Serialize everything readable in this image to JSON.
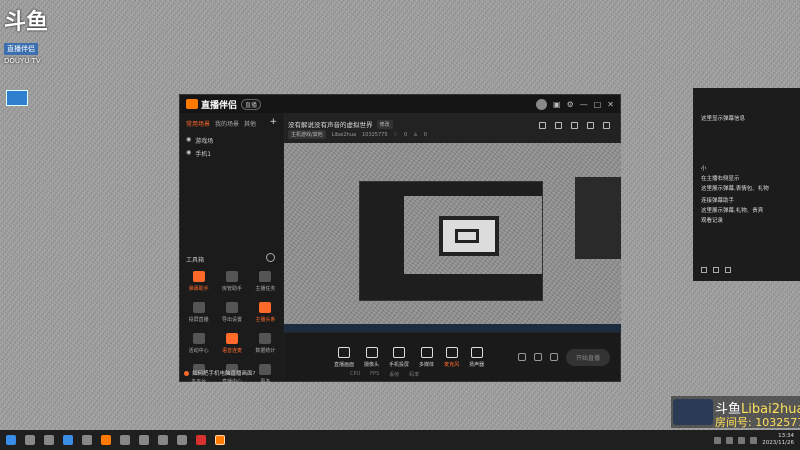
{
  "desktop": {
    "logo_big": "斗鱼",
    "logo_sub": "直播伴侣",
    "logo_caption": "DOUYU TV"
  },
  "app": {
    "brand": "直播伴侣",
    "version_badge": "直播",
    "left": {
      "tabs": [
        "常用场景",
        "我的场景",
        "其他"
      ],
      "sources": [
        "游戏场",
        "手机1"
      ],
      "tools_title": "工具箱",
      "tools": [
        {
          "label": "弹幕助手",
          "orange": true
        },
        {
          "label": "房管助手",
          "orange": false
        },
        {
          "label": "主播任务",
          "orange": false
        },
        {
          "label": "投屏直播",
          "orange": false
        },
        {
          "label": "导出设置",
          "orange": false
        },
        {
          "label": "主播头条",
          "orange": true
        },
        {
          "label": "活动中心",
          "orange": false
        },
        {
          "label": "语音连麦",
          "orange": true
        },
        {
          "label": "数据统计",
          "orange": false
        },
        {
          "label": "多平台",
          "orange": false
        },
        {
          "label": "直播中心",
          "orange": false
        },
        {
          "label": "更多",
          "orange": false
        }
      ],
      "bottom_tip": "如何把手机电脑直播画面?"
    },
    "content": {
      "room_title": "没有解说没有声音的虚拟世界",
      "room_tag": "修改",
      "category": "主机游戏/其他",
      "streamer": "Libai2hua",
      "room_id": "10325775",
      "stats_a": "0",
      "stats_b": "0"
    },
    "bottom_buttons": [
      {
        "label": "直播画面",
        "orange": false
      },
      {
        "label": "摄像头",
        "orange": false
      },
      {
        "label": "手机投屏",
        "orange": false
      },
      {
        "label": "多媒体",
        "orange": false
      },
      {
        "label": "麦克风",
        "orange": true
      },
      {
        "label": "扬声器",
        "orange": false
      }
    ],
    "live_button": "开始直播",
    "bottom_stats": [
      "CPU",
      "FPS",
      "丢帧",
      "码率"
    ]
  },
  "right_panel": {
    "lines": [
      "这里显示弹幕信息",
      "小",
      "在主播右侧显示",
      "这里展示弹幕,表情包、礼物",
      "连接弹幕助手",
      "这里展示弹幕,礼物、贵宾",
      "观看记录"
    ]
  },
  "overlay": {
    "line1_a": "斗鱼",
    "line1_b": "Libai2hua",
    "line2": "房间号: 10325775"
  },
  "taskbar": {
    "time": "13:34",
    "date": "2023/11/26"
  }
}
